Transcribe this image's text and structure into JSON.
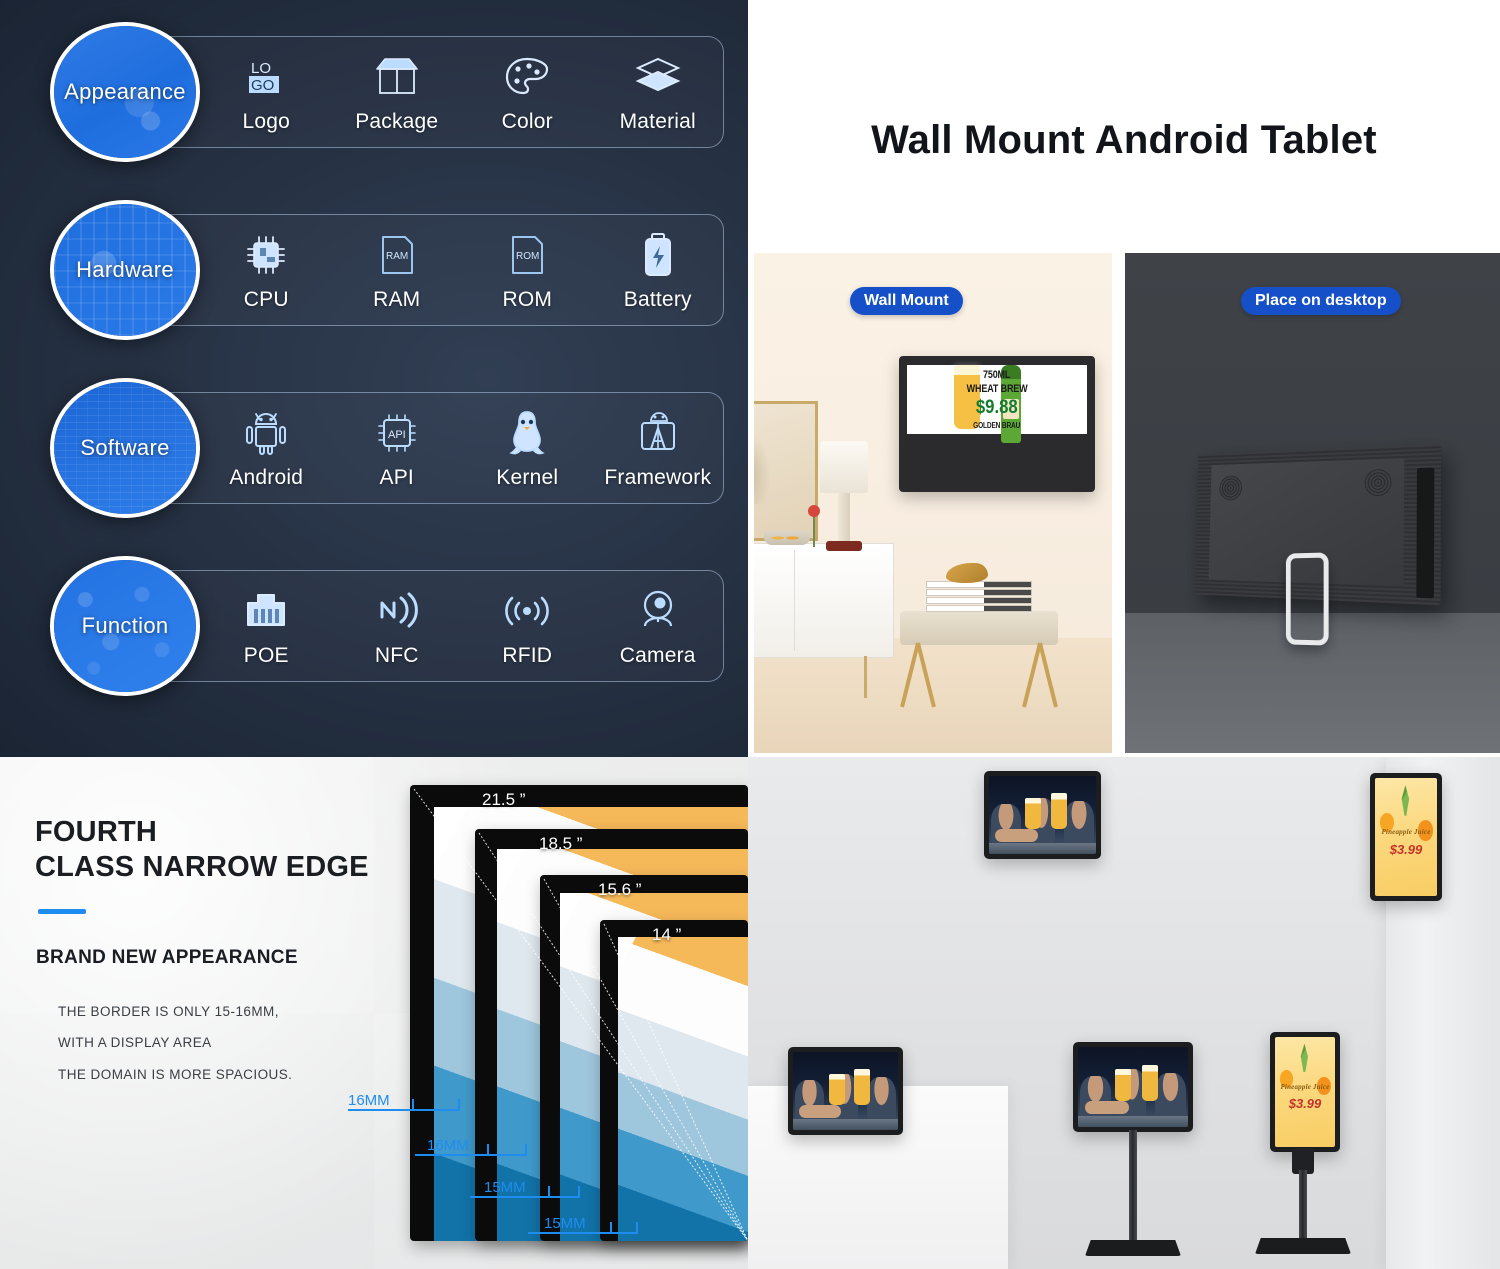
{
  "features": {
    "rows": [
      {
        "category": "Appearance",
        "items": [
          {
            "label": "Logo",
            "icon": "logo-icon"
          },
          {
            "label": "Package",
            "icon": "package-icon"
          },
          {
            "label": "Color",
            "icon": "color-palette-icon"
          },
          {
            "label": "Material",
            "icon": "material-layers-icon"
          }
        ]
      },
      {
        "category": "Hardware",
        "items": [
          {
            "label": "CPU",
            "icon": "cpu-chip-icon"
          },
          {
            "label": "RAM",
            "icon": "ram-card-icon"
          },
          {
            "label": "ROM",
            "icon": "rom-card-icon"
          },
          {
            "label": "Battery",
            "icon": "battery-icon"
          }
        ]
      },
      {
        "category": "Software",
        "items": [
          {
            "label": "Android",
            "icon": "android-robot-icon"
          },
          {
            "label": "API",
            "icon": "api-chip-icon"
          },
          {
            "label": "Kernel",
            "icon": "linux-penguin-icon"
          },
          {
            "label": "Framework",
            "icon": "framework-icon"
          }
        ]
      },
      {
        "category": "Function",
        "items": [
          {
            "label": "POE",
            "icon": "ethernet-port-icon"
          },
          {
            "label": "NFC",
            "icon": "nfc-icon"
          },
          {
            "label": "RFID",
            "icon": "rfid-signal-icon"
          },
          {
            "label": "Camera",
            "icon": "webcam-icon"
          }
        ]
      }
    ],
    "icon_labels": {
      "logo_top": "LO",
      "logo_bottom": "GO",
      "ram_text": "RAM",
      "rom_text": "ROM",
      "api_text": "API"
    }
  },
  "mount": {
    "title": "Wall Mount Android Tablet",
    "wall_badge": "Wall Mount",
    "desk_badge": "Place on desktop",
    "ad": {
      "volume": "750ML",
      "product": "WHEAT BREW",
      "price": "$9.88",
      "brand": "GOLDEN BRAU"
    }
  },
  "bezel": {
    "title_line1": "FOURTH",
    "title_line2": "CLASS NARROW EDGE",
    "subtitle": "BRAND NEW APPEARANCE",
    "body": [
      "THE BORDER IS ONLY 15-16MM,",
      "WITH A DISPLAY AREA",
      "THE DOMAIN IS MORE SPACIOUS."
    ],
    "sizes": [
      {
        "label": "21.5  ”",
        "bezel": "16MM"
      },
      {
        "label": "18.5  ”",
        "bezel": "16MM"
      },
      {
        "label": "15.6  ”",
        "bezel": "15MM"
      },
      {
        "label": "14  ”",
        "bezel": "15MM"
      }
    ],
    "accent_color": "#1f8cf0"
  },
  "scenes": {
    "juice_ad": {
      "title": "Pineapple Juice",
      "price": "$3.99"
    },
    "displays": [
      {
        "name": "counter-top-tablet",
        "content": "bar-scene"
      },
      {
        "name": "floor-stand-landscape",
        "content": "bar-scene"
      },
      {
        "name": "floor-stand-portrait",
        "content": "juice-ad"
      },
      {
        "name": "wall-tablet-landscape",
        "content": "bar-scene"
      },
      {
        "name": "wall-tablet-portrait",
        "content": "juice-ad"
      }
    ]
  },
  "colors": {
    "brand_blue": "#1550c8",
    "accent_blue": "#1f8cf0",
    "circle_blue": "#2472e2",
    "price_green": "#127c2e"
  }
}
